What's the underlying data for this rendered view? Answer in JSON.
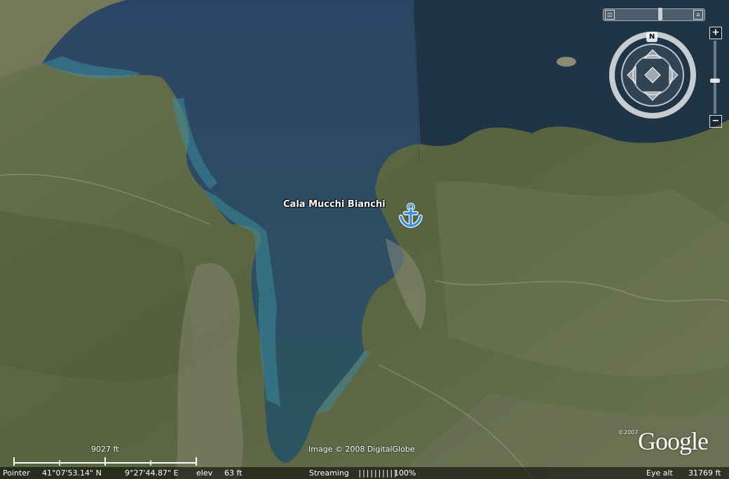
{
  "placemark": {
    "label": "Cala Mucchi Bianchi",
    "icon": "anchor-icon",
    "color": "#3a8fe0"
  },
  "navigation": {
    "compass_north": "N",
    "zoom_in": "+",
    "zoom_out": "−",
    "zoom_level_fraction": 0.55,
    "icons": [
      "look-joystick-icon",
      "tilt-slider-icon",
      "reset-view-icon",
      "move-arrow-icon"
    ]
  },
  "imagery_credit": "Image © 2008 DigitalGlobe",
  "logo": {
    "text": "Google",
    "copyright": "©2007"
  },
  "scale_legend": {
    "label": "9027 ft"
  },
  "status": {
    "pointer_label": "Pointer",
    "lat": "41°07'53.14\" N",
    "lon": "9°27'44.87\" E",
    "elev_label": "elev",
    "elev_value": "63 ft",
    "streaming_label": "Streaming",
    "streaming_bar": "||||||||||",
    "streaming_percent": "100%",
    "eye_alt_label": "Eye alt",
    "eye_alt_value": "31769 ft"
  },
  "colors": {
    "sea": "#26405a",
    "land": "#5a6542",
    "shallow": "#3c8a9c"
  }
}
